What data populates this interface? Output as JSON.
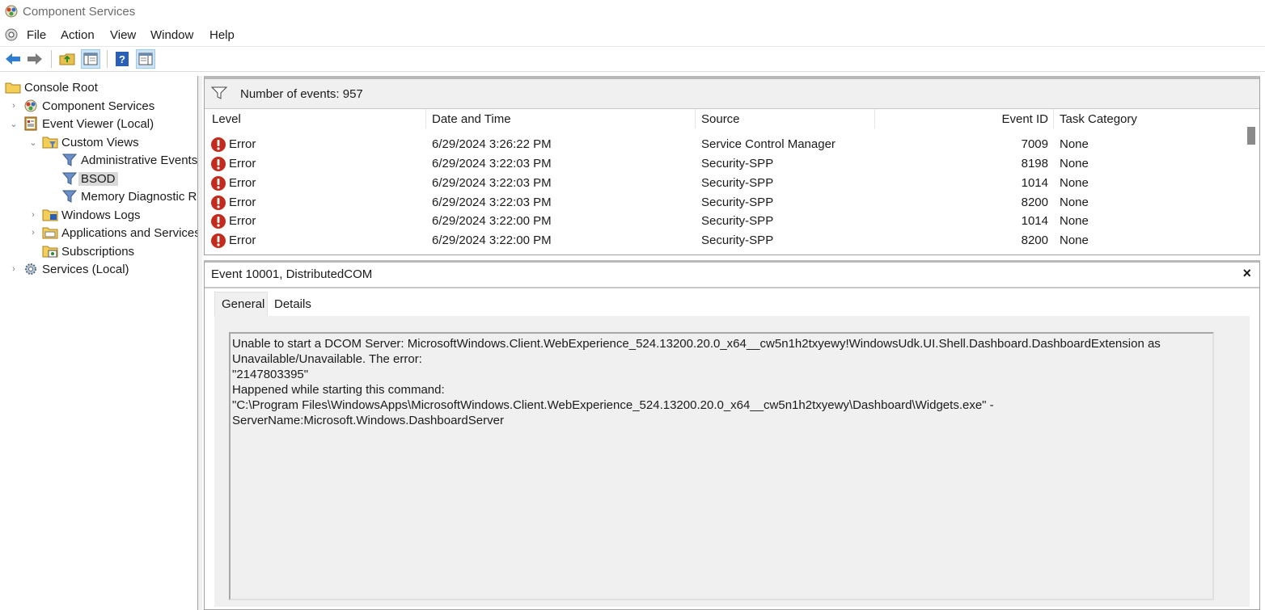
{
  "window": {
    "title": "Component Services"
  },
  "menu": [
    "File",
    "Action",
    "View",
    "Window",
    "Help"
  ],
  "toolbar": {
    "buttons": [
      "back-arrow-icon",
      "forward-arrow-icon",
      "up-folder-icon",
      "show-hide-tree-icon",
      "help-icon",
      "show-hide-action-pane-icon"
    ]
  },
  "tree": {
    "items": [
      {
        "label": "Console Root",
        "icon": "folder-icon"
      },
      {
        "label": "Component Services",
        "icon": "component-services-icon",
        "chevron": "›"
      },
      {
        "label": "Event Viewer (Local)",
        "icon": "event-viewer-icon",
        "chevron": "⌄"
      },
      {
        "label": "Custom Views",
        "icon": "folder-filter-icon",
        "chevron": "⌄"
      },
      {
        "label": "Administrative Events",
        "icon": "filter-icon"
      },
      {
        "label": "BSOD",
        "icon": "filter-icon",
        "selected": true
      },
      {
        "label": "Memory Diagnostic R",
        "icon": "filter-icon"
      },
      {
        "label": "Windows Logs",
        "icon": "windows-logs-icon",
        "chevron": "›"
      },
      {
        "label": "Applications and Services",
        "icon": "app-services-logs-icon",
        "chevron": "›"
      },
      {
        "label": "Subscriptions",
        "icon": "subscriptions-icon"
      },
      {
        "label": "Services (Local)",
        "icon": "gear-icon",
        "chevron": "›"
      }
    ]
  },
  "events": {
    "count_label": "Number of events: 957",
    "columns": [
      "Level",
      "Date and Time",
      "Source",
      "Event ID",
      "Task Category"
    ],
    "rows": [
      {
        "level": "Error",
        "datetime": "6/29/2024 3:26:22 PM",
        "source": "Service Control Manager",
        "event_id": "7009",
        "task": "None"
      },
      {
        "level": "Error",
        "datetime": "6/29/2024 3:22:03 PM",
        "source": "Security-SPP",
        "event_id": "8198",
        "task": "None"
      },
      {
        "level": "Error",
        "datetime": "6/29/2024 3:22:03 PM",
        "source": "Security-SPP",
        "event_id": "1014",
        "task": "None"
      },
      {
        "level": "Error",
        "datetime": "6/29/2024 3:22:03 PM",
        "source": "Security-SPP",
        "event_id": "8200",
        "task": "None"
      },
      {
        "level": "Error",
        "datetime": "6/29/2024 3:22:00 PM",
        "source": "Security-SPP",
        "event_id": "1014",
        "task": "None"
      },
      {
        "level": "Error",
        "datetime": "6/29/2024 3:22:00 PM",
        "source": "Security-SPP",
        "event_id": "8200",
        "task": "None"
      }
    ]
  },
  "detail": {
    "title": "Event 10001, DistributedCOM",
    "close": "×",
    "tabs": [
      "General",
      "Details"
    ],
    "active_tab": "General",
    "description_lines": [
      "Unable to start a DCOM Server: MicrosoftWindows.Client.WebExperience_524.13200.20.0_x64__cw5n1h2txyewy!WindowsUdk.UI.Shell.Dashboard.DashboardExtension as",
      "Unavailable/Unavailable. The error:",
      "\"2147803395\"",
      "Happened while starting this command:",
      "\"C:\\Program Files\\WindowsApps\\MicrosoftWindows.Client.WebExperience_524.13200.20.0_x64__cw5n1h2txyewy\\Dashboard\\Widgets.exe\" -",
      "ServerName:Microsoft.Windows.DashboardServer"
    ]
  },
  "colors": {
    "error": "#c42b1c",
    "selection": "#d9d9d9",
    "accent": "#0078d4"
  }
}
